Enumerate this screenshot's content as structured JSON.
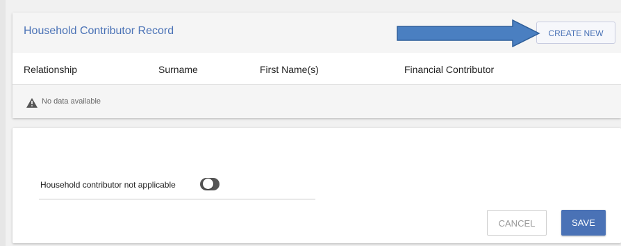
{
  "record": {
    "title": "Household Contributor Record",
    "create_label": "CREATE NEW",
    "columns": [
      "Relationship",
      "Surname",
      "First Name(s)",
      "Financial Contributor"
    ],
    "empty_message": "No data available",
    "empty_icon": "warning-icon"
  },
  "annotation": {
    "icon": "arrow-right-icon",
    "color": "#4a7fc1"
  },
  "form": {
    "toggle_label": "Household contributor not applicable",
    "toggle_on": false,
    "cancel_label": "CANCEL",
    "save_label": "SAVE"
  },
  "colors": {
    "accent": "#4a72b6"
  }
}
